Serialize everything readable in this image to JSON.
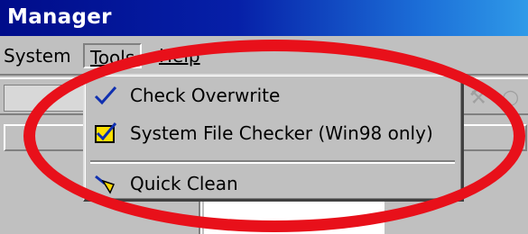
{
  "window": {
    "title": "Manager"
  },
  "menubar": {
    "system": "System",
    "tools": "Tools",
    "help": "Help"
  },
  "tools_menu": {
    "items": [
      {
        "label": "Check Overwrite",
        "icon": "checkmark-icon",
        "checked": true
      },
      {
        "label": "System File Checker (Win98 only)",
        "icon": "checkbox-checked-icon"
      },
      {
        "label": "Quick Clean",
        "icon": "broom-icon"
      }
    ]
  },
  "annotation": {
    "color": "#e8101a",
    "shape": "ellipse"
  },
  "colors": {
    "titlebar_start": "#000c8a",
    "titlebar_end": "#2f9ae8",
    "face": "#c0c0c0"
  }
}
